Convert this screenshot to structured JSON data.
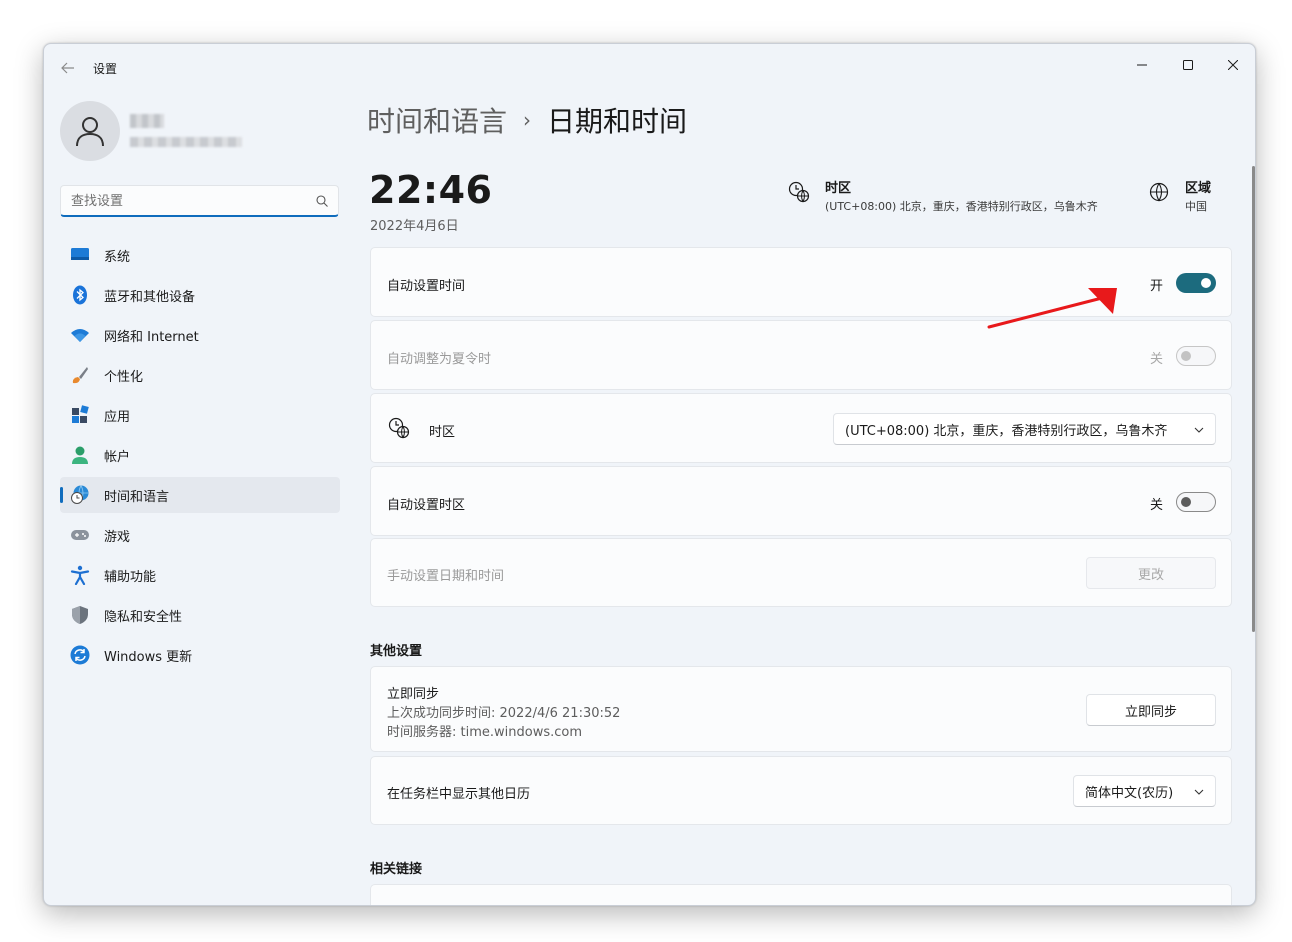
{
  "window": {
    "app_title": "设置"
  },
  "search": {
    "placeholder": "查找设置"
  },
  "sidebar": {
    "items": [
      {
        "label": "系统",
        "icon": "display-icon"
      },
      {
        "label": "蓝牙和其他设备",
        "icon": "bluetooth-icon"
      },
      {
        "label": "网络和 Internet",
        "icon": "wifi-icon"
      },
      {
        "label": "个性化",
        "icon": "brush-icon"
      },
      {
        "label": "应用",
        "icon": "apps-icon"
      },
      {
        "label": "帐户",
        "icon": "person-icon"
      },
      {
        "label": "时间和语言",
        "icon": "globe-clock-icon",
        "active": true
      },
      {
        "label": "游戏",
        "icon": "gamepad-icon"
      },
      {
        "label": "辅助功能",
        "icon": "accessibility-icon"
      },
      {
        "label": "隐私和安全性",
        "icon": "shield-icon"
      },
      {
        "label": "Windows 更新",
        "icon": "refresh-icon"
      }
    ]
  },
  "breadcrumb": {
    "parent": "时间和语言",
    "separator": "›",
    "current": "日期和时间"
  },
  "clock": {
    "time": "22:46",
    "date": "2022年4月6日"
  },
  "timezone_info": {
    "label": "时区",
    "value": "(UTC+08:00) 北京，重庆，香港特别行政区，乌鲁木齐"
  },
  "region_info": {
    "label": "区域",
    "value": "中国"
  },
  "settings": {
    "auto_time": {
      "label": "自动设置时间",
      "state": "开",
      "on": true
    },
    "dst": {
      "label": "自动调整为夏令时",
      "state": "关",
      "on": false,
      "disabled": true
    },
    "timezone": {
      "label": "时区",
      "selected": "(UTC+08:00) 北京，重庆，香港特别行政区，乌鲁木齐"
    },
    "auto_timezone": {
      "label": "自动设置时区",
      "state": "关",
      "on": false
    },
    "manual": {
      "label": "手动设置日期和时间",
      "button": "更改",
      "disabled": true
    }
  },
  "other_settings": {
    "title": "其他设置",
    "sync": {
      "label": "立即同步",
      "last_sync": "上次成功同步时间: 2022/4/6 21:30:52",
      "server": "时间服务器: time.windows.com",
      "button": "立即同步"
    },
    "calendar": {
      "label": "在任务栏中显示其他日历",
      "selected": "简体中文(农历)"
    }
  },
  "related": {
    "title": "相关链接"
  },
  "colors": {
    "accent": "#0f6cbd",
    "toggle_on": "#1c6b7e",
    "annotation_arrow": "#e8191b"
  }
}
